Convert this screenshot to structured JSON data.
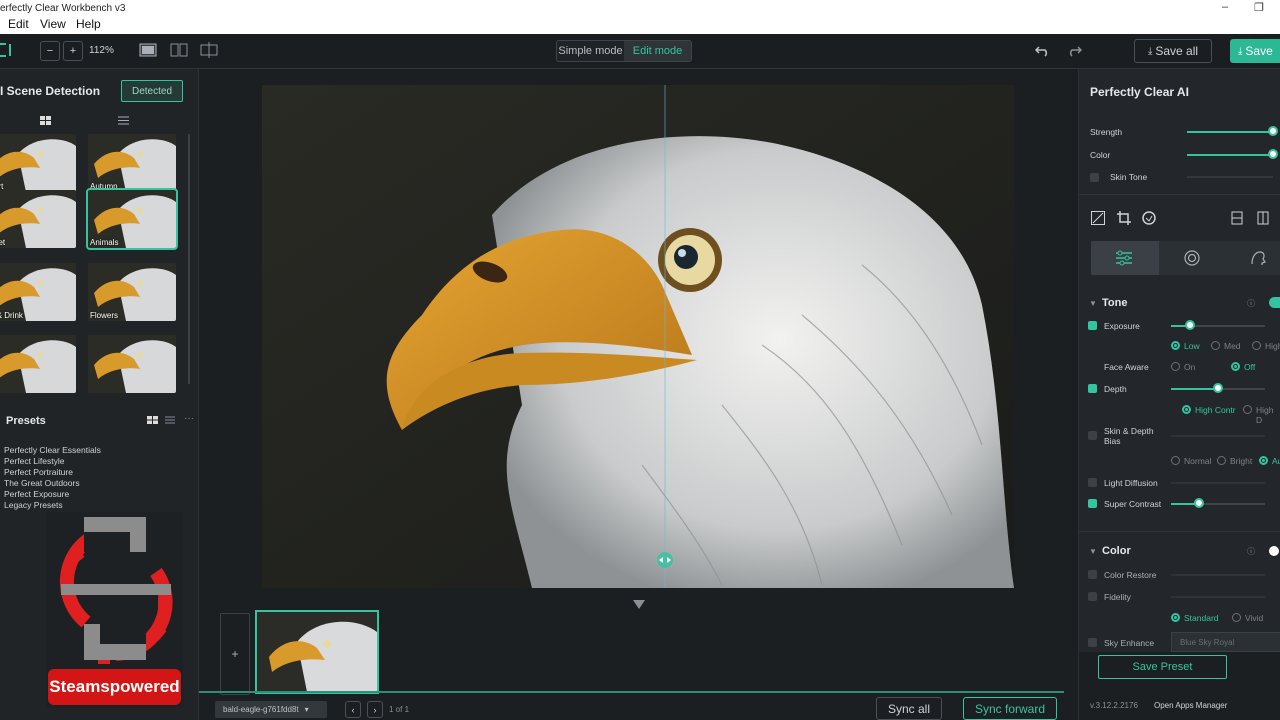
{
  "app": {
    "title": "erfectly Clear Workbench v3"
  },
  "menu": {
    "edit": "Edit",
    "view": "View",
    "help": "Help"
  },
  "toolbar": {
    "zoom": "112%",
    "simple_mode": "Simple mode",
    "edit_mode": "Edit mode",
    "save_all": "Save all",
    "save": "Save"
  },
  "left": {
    "scene_title": "I Scene Detection",
    "detected_btn": "Detected",
    "thumbs": [
      "sert",
      "Autumn",
      "nset",
      "Animals",
      "d & Drink",
      "Flowers",
      "",
      ""
    ],
    "presets_title": "Presets",
    "presets": [
      "Perfectly Clear Essentials",
      "Perfect Lifestyle",
      "Perfect Portraiture",
      "The Great Outdoors",
      "Perfect Exposure",
      "Legacy Presets"
    ]
  },
  "watermark": {
    "text": "Steamspowered"
  },
  "bottom": {
    "file_name": "bald-eagle-g761fdd8t",
    "page": "1 of 1",
    "sync_all": "Sync all",
    "sync_forward": "Sync forward",
    "add": "+"
  },
  "right": {
    "ai_title": "Perfectly Clear AI",
    "strength": "Strength",
    "strength_value": 1.0,
    "color_label": "Color",
    "color_value": 1.0,
    "skin_tone": "Skin Tone",
    "tone_title": "Tone",
    "exposure": "Exposure",
    "exposure_value": 0.2,
    "exposure_opts": [
      "Low",
      "Med",
      "High"
    ],
    "face_aware": "Face Aware",
    "face_opts": [
      "On",
      "Off"
    ],
    "depth": "Depth",
    "depth_value": 0.5,
    "depth_opts": [
      "High Contr",
      "High D"
    ],
    "skin_depth": "Skin & Depth Bias",
    "bias_opts": [
      "Normal",
      "Bright",
      "Au"
    ],
    "light_diffusion": "Light Diffusion",
    "super_contrast": "Super Contrast",
    "super_contrast_value": 0.3,
    "color_title": "Color",
    "color_restore": "Color Restore",
    "fidelity": "Fidelity",
    "fidelity_opts": [
      "Standard",
      "Vivid"
    ],
    "sky_enhance": "Sky Enhance",
    "sky_value": "Blue Sky Royal",
    "save_preset": "Save Preset",
    "version": "v.3.12.2.2176",
    "apps_manager": "Open Apps Manager"
  },
  "colors": {
    "accent": "#35c4a0",
    "panel": "#23272b",
    "canvas": "#1c1f22"
  }
}
